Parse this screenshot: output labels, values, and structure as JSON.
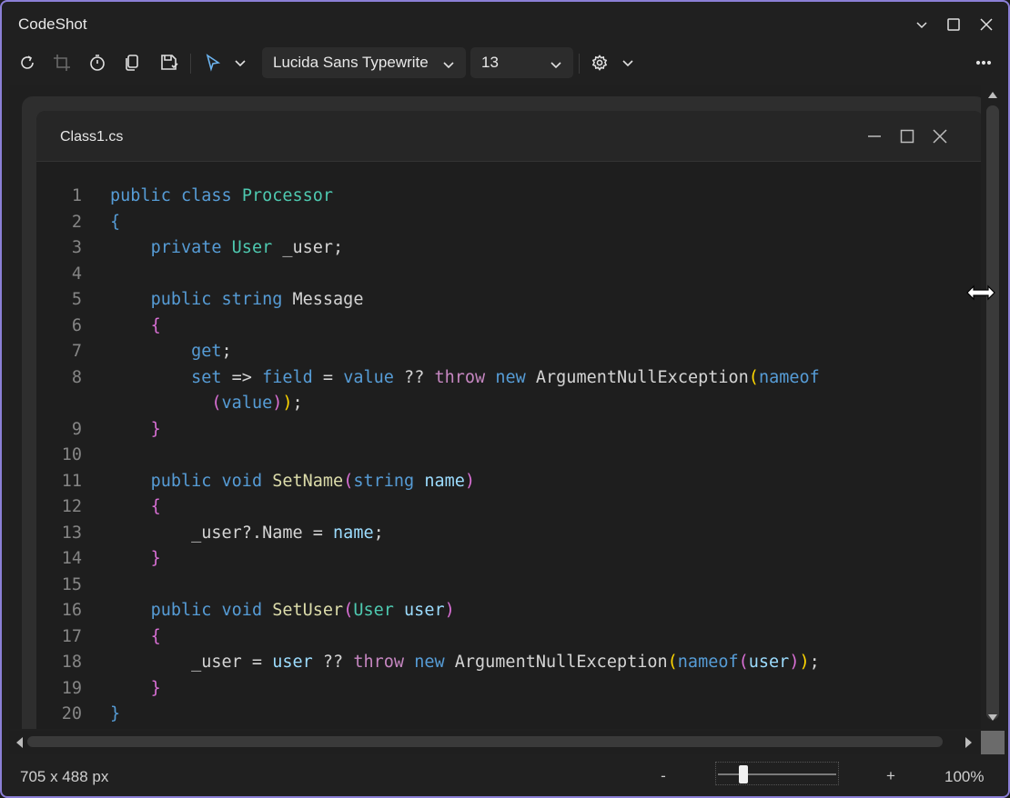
{
  "app": {
    "title": "CodeShot"
  },
  "toolbar": {
    "font_family": "Lucida Sans Typewrite",
    "font_size": "13",
    "icons": [
      "refresh-icon",
      "crop-icon",
      "timer-icon",
      "copy-icon",
      "save-icon",
      "cursor-icon",
      "settings-icon",
      "more-icon"
    ]
  },
  "editor": {
    "file_title": "Class1.cs",
    "lines": [
      {
        "n": "1",
        "tokens": [
          [
            "kw",
            "public"
          ],
          [
            "pl",
            " "
          ],
          [
            "kw",
            "class"
          ],
          [
            "pl",
            " "
          ],
          [
            "ty",
            "Processor"
          ]
        ]
      },
      {
        "n": "2",
        "tokens": [
          [
            "b1",
            "{"
          ]
        ]
      },
      {
        "n": "3",
        "tokens": [
          [
            "pl",
            "    "
          ],
          [
            "kw",
            "private"
          ],
          [
            "pl",
            " "
          ],
          [
            "ty",
            "User"
          ],
          [
            "pl",
            " _user;"
          ]
        ]
      },
      {
        "n": "4",
        "tokens": []
      },
      {
        "n": "5",
        "tokens": [
          [
            "pl",
            "    "
          ],
          [
            "kw",
            "public"
          ],
          [
            "pl",
            " "
          ],
          [
            "kw",
            "string"
          ],
          [
            "pl",
            " Message"
          ]
        ]
      },
      {
        "n": "6",
        "tokens": [
          [
            "pl",
            "    "
          ],
          [
            "b2",
            "{"
          ]
        ]
      },
      {
        "n": "7",
        "tokens": [
          [
            "pl",
            "        "
          ],
          [
            "kw",
            "get"
          ],
          [
            "pl",
            ";"
          ]
        ]
      },
      {
        "n": "8",
        "tokens": [
          [
            "pl",
            "        "
          ],
          [
            "kw",
            "set"
          ],
          [
            "pl",
            " => "
          ],
          [
            "kw",
            "field"
          ],
          [
            "pl",
            " = "
          ],
          [
            "kw",
            "value"
          ],
          [
            "pl",
            " ?? "
          ],
          [
            "ctl",
            "throw"
          ],
          [
            "pl",
            " "
          ],
          [
            "kw",
            "new"
          ],
          [
            "pl",
            " ArgumentNullException"
          ],
          [
            "b3",
            "("
          ],
          [
            "kw",
            "nameof"
          ]
        ]
      },
      {
        "n": "",
        "tokens": [
          [
            "pl",
            "          "
          ],
          [
            "b2",
            "("
          ],
          [
            "kw",
            "value"
          ],
          [
            "b2",
            ")"
          ],
          [
            "b3",
            ")"
          ],
          [
            "pl",
            ";"
          ]
        ]
      },
      {
        "n": "9",
        "tokens": [
          [
            "pl",
            "    "
          ],
          [
            "b2",
            "}"
          ]
        ]
      },
      {
        "n": "10",
        "tokens": []
      },
      {
        "n": "11",
        "tokens": [
          [
            "pl",
            "    "
          ],
          [
            "kw",
            "public"
          ],
          [
            "pl",
            " "
          ],
          [
            "kw",
            "void"
          ],
          [
            "pl",
            " "
          ],
          [
            "fn",
            "SetName"
          ],
          [
            "b2",
            "("
          ],
          [
            "kw",
            "string"
          ],
          [
            "pl",
            " "
          ],
          [
            "vr",
            "name"
          ],
          [
            "b2",
            ")"
          ]
        ]
      },
      {
        "n": "12",
        "tokens": [
          [
            "pl",
            "    "
          ],
          [
            "b2",
            "{"
          ]
        ]
      },
      {
        "n": "13",
        "tokens": [
          [
            "pl",
            "        _user?.Name = "
          ],
          [
            "vr",
            "name"
          ],
          [
            "pl",
            ";"
          ]
        ]
      },
      {
        "n": "14",
        "tokens": [
          [
            "pl",
            "    "
          ],
          [
            "b2",
            "}"
          ]
        ]
      },
      {
        "n": "15",
        "tokens": []
      },
      {
        "n": "16",
        "tokens": [
          [
            "pl",
            "    "
          ],
          [
            "kw",
            "public"
          ],
          [
            "pl",
            " "
          ],
          [
            "kw",
            "void"
          ],
          [
            "pl",
            " "
          ],
          [
            "fn",
            "SetUser"
          ],
          [
            "b2",
            "("
          ],
          [
            "ty",
            "User"
          ],
          [
            "pl",
            " "
          ],
          [
            "vr",
            "user"
          ],
          [
            "b2",
            ")"
          ]
        ]
      },
      {
        "n": "17",
        "tokens": [
          [
            "pl",
            "    "
          ],
          [
            "b2",
            "{"
          ]
        ]
      },
      {
        "n": "18",
        "tokens": [
          [
            "pl",
            "        _user = "
          ],
          [
            "vr",
            "user"
          ],
          [
            "pl",
            " ?? "
          ],
          [
            "ctl",
            "throw"
          ],
          [
            "pl",
            " "
          ],
          [
            "kw",
            "new"
          ],
          [
            "pl",
            " ArgumentNullException"
          ],
          [
            "b3",
            "("
          ],
          [
            "kw",
            "nameof"
          ],
          [
            "b2",
            "("
          ],
          [
            "vr",
            "user"
          ],
          [
            "b2",
            ")"
          ],
          [
            "b3",
            ")"
          ],
          [
            "pl",
            ";"
          ]
        ]
      },
      {
        "n": "19",
        "tokens": [
          [
            "pl",
            "    "
          ],
          [
            "b2",
            "}"
          ]
        ]
      },
      {
        "n": "20",
        "tokens": [
          [
            "b1",
            "}"
          ]
        ]
      }
    ]
  },
  "status": {
    "dimensions": "705 x 488 px",
    "zoom_minus": "-",
    "zoom_plus": "+",
    "zoom_percent": "100%",
    "zoom_level": 0.2
  }
}
